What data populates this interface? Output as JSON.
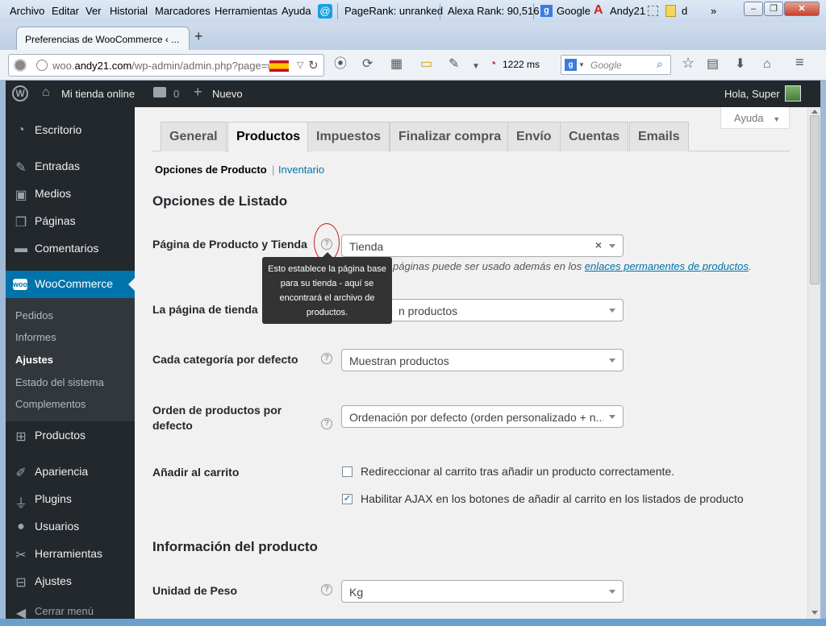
{
  "browser": {
    "menu": [
      "Archivo",
      "Editar",
      "Ver",
      "Historial",
      "Marcadores",
      "Herramientas",
      "Ayuda"
    ],
    "pagerank": "PageRank: unranked",
    "alexa": "Alexa Rank: 90,516",
    "bookmarks": [
      "Google",
      "Andy21",
      "d"
    ],
    "more": "»",
    "tab_title": "Preferencias de WooCommerce ‹ ...",
    "new_tab": "+",
    "url": {
      "prefix": "woo.",
      "domain": "andy21.com",
      "path": "/wp-admin/admin.php?page=w"
    },
    "load_time": "1222 ms",
    "search_placeholder": "Google"
  },
  "adminbar": {
    "site_name": "Mi tienda online",
    "comments_count": "0",
    "new_label": "Nuevo",
    "greeting": "Hola, Super"
  },
  "sidebar": {
    "items": [
      {
        "label": "Escritorio",
        "icon": "dashboard-icon"
      },
      {
        "label": "Entradas",
        "icon": "pin-icon"
      },
      {
        "label": "Medios",
        "icon": "media-icon"
      },
      {
        "label": "Páginas",
        "icon": "pages-icon"
      },
      {
        "label": "Comentarios",
        "icon": "comments-icon"
      },
      {
        "label": "WooCommerce",
        "icon": "woocommerce-icon"
      },
      {
        "label": "Productos",
        "icon": "cart-icon"
      },
      {
        "label": "Apariencia",
        "icon": "brush-icon"
      },
      {
        "label": "Plugins",
        "icon": "plugin-icon"
      },
      {
        "label": "Usuarios",
        "icon": "user-icon"
      },
      {
        "label": "Herramientas",
        "icon": "wrench-icon"
      },
      {
        "label": "Ajustes",
        "icon": "settings-icon"
      },
      {
        "label": "Cerrar menú",
        "icon": "collapse-icon"
      }
    ],
    "woo_submenu": [
      "Pedidos",
      "Informes",
      "Ajustes",
      "Estado del sistema",
      "Complementos"
    ]
  },
  "content": {
    "help_button": "Ayuda",
    "tabs": [
      "General",
      "Productos",
      "Impuestos",
      "Finalizar compra",
      "Envío",
      "Cuentas",
      "Emails"
    ],
    "active_tab": "Productos",
    "subnav": {
      "current": "Opciones de Producto",
      "sep": "|",
      "other": "Inventario"
    },
    "section1_title": "Opciones de Listado",
    "rows": {
      "shop_page": {
        "label": "Página de Producto y Tienda",
        "value": "Tienda",
        "desc_prefix": "páginas puede ser usado además en los",
        "desc_link": "enlaces permanentes de productos",
        "desc_suffix": "."
      },
      "shop_display": {
        "label": "La página de tienda",
        "value": "n productos"
      },
      "category_display": {
        "label": "Cada categoría por defecto",
        "value": "Muestran productos"
      },
      "default_sort": {
        "label": "Orden de productos por defecto",
        "value": "Ordenación por defecto (orden personalizado + n..."
      },
      "add_to_cart": {
        "label": "Añadir al carrito",
        "option1": "Redireccionar al carrito tras añadir un producto correctamente.",
        "option2": "Habilitar AJAX en los botones de añadir al carrito en los listados de producto"
      }
    },
    "tooltip": "Esto establece la página base para su tienda - aquí se encontrará el archivo de productos.",
    "section2_title": "Información del producto",
    "weight_unit": {
      "label": "Unidad de Peso",
      "value": "Kg"
    }
  },
  "colors": {
    "adminbar_bg": "#23282d",
    "menu_current": "#0073aa",
    "link": "#0073aa",
    "highlight_circle": "#cc1f1f"
  },
  "state": {
    "redirect_checked": false,
    "ajax_checked": true
  }
}
